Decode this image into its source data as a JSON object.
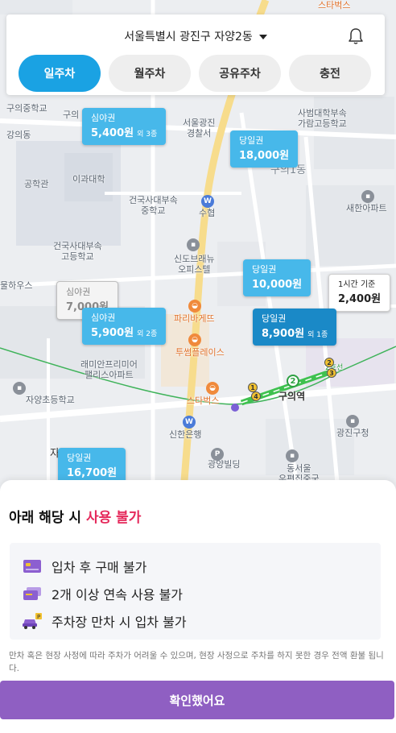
{
  "header": {
    "location": "서울특별시 광진구 자양2동",
    "tabs": [
      {
        "label": "일주차",
        "active": true
      },
      {
        "label": "월주차",
        "active": false
      },
      {
        "label": "공유주차",
        "active": false
      },
      {
        "label": "충전",
        "active": false
      }
    ]
  },
  "map": {
    "labels": {
      "univ_top": "구의중학교",
      "guui_top": "구의",
      "ganguidong": "강의동",
      "police": "서울광진\n경찰서",
      "sahyeop": "사범대학부속\n가람고등학교",
      "guui1dong": "구의1동",
      "igwa": "이과대학",
      "gonghak": "공학관",
      "konkuk_mid": "건국사대부속\n중학교",
      "suheop": "수협",
      "saehan": "새한아파트",
      "konkuk_high": "건국사대부속\n고등학교",
      "sindo": "신도브래뉴\n오피스텔",
      "hanhouse": "물하우스",
      "paris": "파리바게뜨",
      "twosome": "투썸플레이스",
      "raemian": "래미안프리미어\n팰리스아파트",
      "yangjin": "자양초등학교",
      "starbucks_mid": "스타벅스",
      "guui_station": "구의역",
      "shinhan": "신한은행",
      "gwangjin_gu": "광진구청",
      "gwangyang": "광양빌딩",
      "dongseoul": "동서울\n우편집중국",
      "starbucks_top": "스타벅스",
      "line_tag": "2호선",
      "ja": "자"
    },
    "pins": [
      {
        "type": "심야권",
        "price": "5,400원",
        "extra": "외 3종",
        "style": "light"
      },
      {
        "type": "당일권",
        "price": "18,000원",
        "extra": "",
        "style": "light"
      },
      {
        "type": "당일권",
        "price": "10,000원",
        "extra": "",
        "style": "light"
      },
      {
        "type": "1시간 기준",
        "price": "2,400원",
        "extra": "",
        "style": "white"
      },
      {
        "type": "심야권",
        "price": "7,000원",
        "extra": "",
        "style": "gray"
      },
      {
        "type": "심야권",
        "price": "5,900원",
        "extra": "외 2종",
        "style": "light"
      },
      {
        "type": "당일권",
        "price": "8,900원",
        "extra": "외 1종",
        "style": "dark"
      },
      {
        "type": "당일권",
        "price": "16,700원",
        "extra": "",
        "style": "light"
      }
    ]
  },
  "sheet": {
    "title_prefix": "아래 해당 시 ",
    "title_warn": "사용 불가",
    "rules": [
      {
        "icon": "card-icon",
        "label": "입차 후 구매 불가"
      },
      {
        "icon": "ticket-icon",
        "label": "2개 이상 연속 사용 불가"
      },
      {
        "icon": "full-parking-icon",
        "label": "주차장 만차 시 입차 불가"
      }
    ],
    "note": "만차 혹은 현장 사정에 따라 주차가 어려울 수 있으며, 현장 사정으로 주차를 하지 못한 경우 전액 환불 됩니다.",
    "confirm_label": "확인했어요"
  },
  "colors": {
    "tab_active": "#1aa2e3",
    "pin_light": "#47b8ea",
    "pin_dark": "#1a89c7",
    "warn": "#e5295b",
    "confirm": "#8f5fc2"
  }
}
